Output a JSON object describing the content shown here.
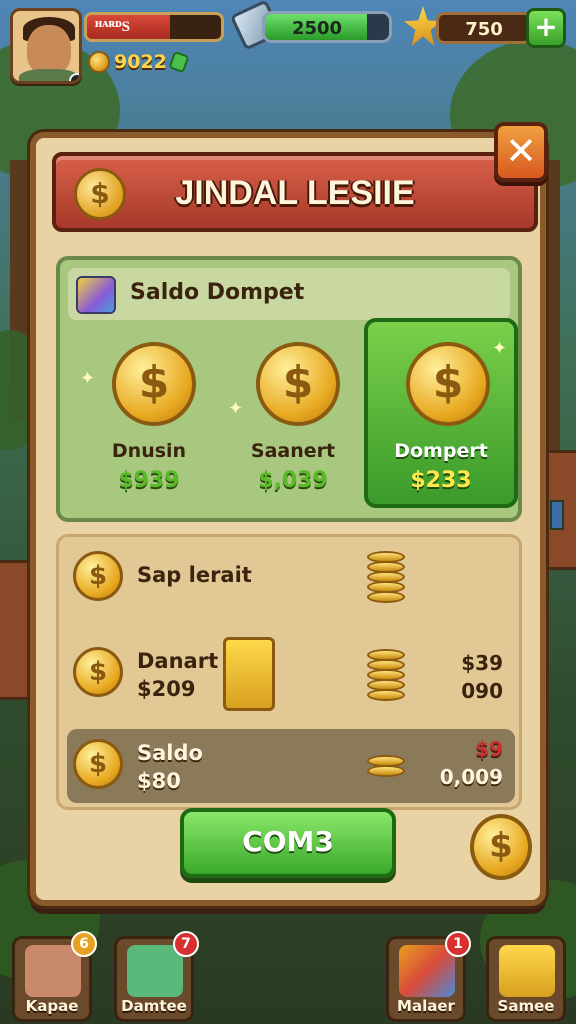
{
  "hud": {
    "player_name": "ᴴᴬᴿᴰS",
    "gold": "9022",
    "energy": "2500",
    "energy_level": 0.82,
    "stars": "750",
    "plus_label": "+"
  },
  "panel": {
    "title": "JINDAL LESIIE",
    "close_label": "✕",
    "coin_symbol": "$"
  },
  "wallet": {
    "title": "Saldo Dompet",
    "cards": [
      {
        "label": "Dnusin",
        "amount": "$939"
      },
      {
        "label": "Saanert",
        "amount": "$,039"
      },
      {
        "label": "Dompert",
        "amount": "$233"
      }
    ]
  },
  "list": {
    "rows": [
      {
        "label": "Sap lerait",
        "sub": "",
        "right_top": "",
        "right_bottom": ""
      },
      {
        "label": "Danart",
        "sub": "$209",
        "right_top": "$39",
        "right_bottom": "090"
      },
      {
        "label": "Saldo",
        "sub": "$80",
        "right_top": "$9",
        "right_bottom": "0,009"
      }
    ]
  },
  "action": {
    "button_label": "COM3"
  },
  "nav": {
    "items": [
      {
        "label": "Kapae",
        "badge": "6"
      },
      {
        "label": "Damtee",
        "badge": "7"
      },
      {
        "label": "Malaer",
        "badge": "1"
      },
      {
        "label": "Samee",
        "badge": ""
      }
    ]
  },
  "colors": {
    "accent_green": "#3aa02a",
    "banner_red": "#a8392a",
    "gold": "#e8a820"
  }
}
